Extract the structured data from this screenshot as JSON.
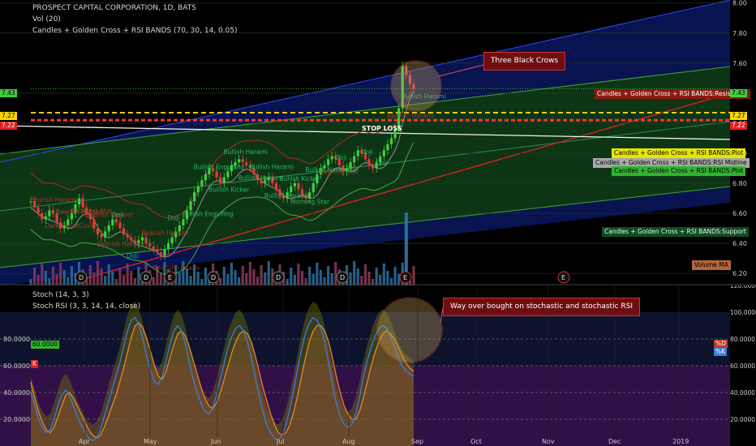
{
  "header": {
    "title": "PROSPECT CAPITAL CORPORATION, 1D, BATS",
    "vol_label": "Vol (20)",
    "study_label": "Candles + Golden Cross + RSI BANDS (70, 30, 14, 0.05)"
  },
  "lower_pane": {
    "stoch_label": "Stoch (14, 3, 3)",
    "stoch_rsi_label": "Stoch RSI (3, 3, 14, 14, close)",
    "left_tags": [
      "60.0000",
      "K"
    ],
    "right_tags": [
      "%D",
      "%K"
    ]
  },
  "callouts": {
    "crows": "Three Black Crows",
    "stoch": "Way over bought on stochastic and stochastic RSI"
  },
  "price_tags": {
    "resistance": "Candles + Golden Cross + RSI BANDS:Resistance",
    "plot1": "Candles + Golden Cross + RSI BANDS:Plot",
    "midline": "Candles + Golden Cross + RSI BANDS:RSI Midline",
    "plot2": "Candles + Golden Cross + RSI BANDS:Plot",
    "support": "Candles + Golden Cross + RSI BANDS:Support",
    "volume_ma": "Volume MA",
    "stop_loss": "STOP LOSS"
  },
  "price_markers": {
    "left": [
      "7.43",
      "7.27",
      "7.22"
    ],
    "right": [
      "7.43",
      "7.27",
      "7.22"
    ]
  },
  "pattern_labels": [
    "Bearish Harami",
    "Dark CloudCover",
    "Bearish Harami",
    "Shooting Star",
    "Bearish Harami",
    "Bearish Harami",
    "Doji",
    "Doji",
    "Bearish Harami",
    "Bearish Harami",
    "Doji",
    "Bullish Engulfing",
    "Bullish Engulfing",
    "Bullish Kicker",
    "Bullish Harami",
    "Bullish Harami",
    "Bullish Harami",
    "Bullish Harami",
    "Bullish Kicker",
    "Morning Star",
    "Bullish Harami",
    "Evening Star",
    "Doji",
    "Doji",
    "Doji",
    "Doji",
    "Bearish Harami",
    "Bullish Harami"
  ],
  "event_markers": [
    "D",
    "D",
    "E",
    "D",
    "D",
    "D",
    "E",
    "E"
  ],
  "colors": {
    "background": "#000000",
    "up_candle": "#3ecf3e",
    "down_candle": "#e23b3b",
    "channel_fill": "#0e3a0e",
    "outer_band": "#0b1a6b",
    "stoch_d": "#e08a2a",
    "stoch_k": "#3a7fd6",
    "overbought_fill": "#8a8a00",
    "stop_loss_line": "#ff3333",
    "target_line": "#ffd700"
  },
  "chart_data": [
    {
      "type": "candlestick",
      "title": "PROSPECT CAPITAL CORPORATION, 1D, BATS",
      "x_tick_labels": [
        "Apr",
        "May",
        "Jun",
        "Jul",
        "Aug",
        "Sep",
        "Oct",
        "Nov",
        "Dec",
        "2019"
      ],
      "y_tick_labels": [
        "8.00",
        "7.80",
        "7.60",
        "7.40",
        "7.20",
        "7.00",
        "6.80",
        "6.60",
        "6.40",
        "6.20"
      ],
      "ylim": [
        6.12,
        8.02
      ],
      "close": [
        6.68,
        6.64,
        6.6,
        6.56,
        6.58,
        6.62,
        6.6,
        6.54,
        6.5,
        6.52,
        6.56,
        6.6,
        6.66,
        6.7,
        6.64,
        6.6,
        6.56,
        6.5,
        6.46,
        6.44,
        6.48,
        6.52,
        6.56,
        6.54,
        6.5,
        6.46,
        6.44,
        6.42,
        6.4,
        6.42,
        6.44,
        6.4,
        6.38,
        6.36,
        6.34,
        6.32,
        6.36,
        6.4,
        6.44,
        6.48,
        6.52,
        6.56,
        6.62,
        6.68,
        6.74,
        6.78,
        6.82,
        6.86,
        6.9,
        6.88,
        6.84,
        6.8,
        6.84,
        6.88,
        6.92,
        6.94,
        6.96,
        6.94,
        6.92,
        6.9,
        6.86,
        6.82,
        6.8,
        6.82,
        6.84,
        6.8,
        6.76,
        6.72,
        6.7,
        6.74,
        6.78,
        6.8,
        6.76,
        6.72,
        6.7,
        6.74,
        6.8,
        6.86,
        6.9,
        6.92,
        6.96,
        6.98,
        6.96,
        6.92,
        6.88,
        6.9,
        6.94,
        6.98,
        7.02,
        7.0,
        6.96,
        6.92,
        6.9,
        6.94,
        6.98,
        7.02,
        7.06,
        7.1,
        7.16,
        7.3,
        7.58,
        7.52,
        7.46,
        7.43
      ],
      "levels": {
        "current": 7.43,
        "target": 7.27,
        "stop_loss": 7.22
      }
    },
    {
      "type": "line",
      "title": "Stoch (14, 3, 3) / Stoch RSI (3, 3, 14, 14, close)",
      "x_tick_labels": [
        "Apr",
        "May",
        "Jun",
        "Jul",
        "Aug",
        "Sep",
        "Oct",
        "Nov",
        "Dec",
        "2019"
      ],
      "y_tick_labels": [
        "120.0000",
        "100.0000",
        "80.0000",
        "60.0000",
        "40.0000",
        "20.0000"
      ],
      "ylim": [
        0,
        100
      ],
      "series": [
        {
          "name": "%D",
          "values": [
            48,
            36,
            26,
            18,
            12,
            10,
            14,
            22,
            30,
            38,
            40,
            36,
            30,
            24,
            18,
            12,
            8,
            6,
            8,
            14,
            22,
            30,
            38,
            48,
            58,
            70,
            82,
            90,
            92,
            88,
            80,
            70,
            60,
            52,
            50,
            56,
            66,
            76,
            84,
            86,
            82,
            74,
            64,
            54,
            44,
            36,
            30,
            28,
            32,
            40,
            50,
            60,
            70,
            78,
            84,
            86,
            84,
            78,
            68,
            56,
            44,
            34,
            24,
            16,
            10,
            8,
            10,
            16,
            26,
            38,
            52,
            66,
            78,
            86,
            90,
            90,
            86,
            78,
            66,
            52,
            40,
            30,
            24,
            20,
            20,
            26,
            36,
            48,
            60,
            70,
            78,
            84,
            86,
            84,
            80,
            74,
            68,
            62,
            58,
            56
          ]
        },
        {
          "name": "%K",
          "values": [
            40,
            30,
            20,
            14,
            10,
            12,
            20,
            30,
            38,
            42,
            38,
            30,
            22,
            16,
            10,
            6,
            4,
            6,
            12,
            22,
            32,
            42,
            52,
            62,
            74,
            86,
            94,
            96,
            90,
            80,
            66,
            56,
            48,
            46,
            52,
            64,
            76,
            86,
            90,
            86,
            76,
            62,
            50,
            40,
            32,
            26,
            24,
            28,
            38,
            50,
            62,
            74,
            82,
            88,
            90,
            86,
            78,
            66,
            52,
            38,
            26,
            16,
            10,
            6,
            4,
            8,
            16,
            28,
            42,
            58,
            72,
            84,
            92,
            96,
            94,
            88,
            78,
            62,
            46,
            32,
            22,
            16,
            14,
            16,
            24,
            36,
            52,
            64,
            74,
            82,
            88,
            90,
            88,
            82,
            74,
            66,
            60,
            56,
            54,
            52
          ]
        }
      ]
    }
  ]
}
